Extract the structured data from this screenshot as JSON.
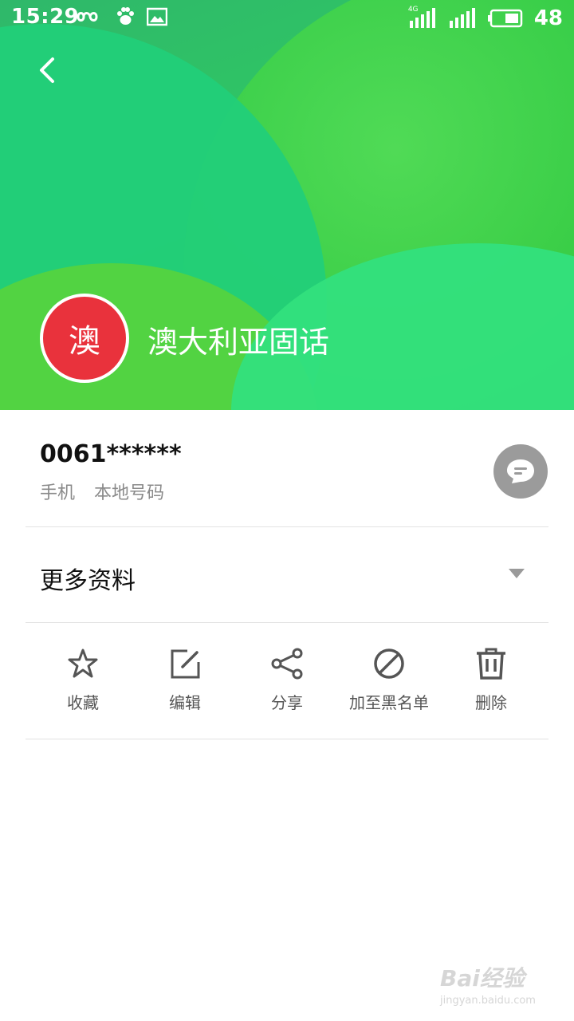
{
  "status_bar": {
    "time": "15:29",
    "network_label": "4G",
    "battery": "48"
  },
  "contact": {
    "avatar_char": "澳",
    "name": "澳大利亚固话",
    "avatar_color": "#e9323c"
  },
  "phone": {
    "number": "0061******",
    "type": "手机",
    "location": "本地号码"
  },
  "more_info": {
    "label": "更多资料"
  },
  "actions": [
    {
      "label": "收藏",
      "icon": "star-icon"
    },
    {
      "label": "编辑",
      "icon": "edit-icon"
    },
    {
      "label": "分享",
      "icon": "share-icon"
    },
    {
      "label": "加至黑名单",
      "icon": "block-icon"
    },
    {
      "label": "删除",
      "icon": "trash-icon"
    }
  ],
  "watermark": {
    "brand": "Bai经验",
    "url": "jingyan.baidu.com"
  },
  "colors": {
    "header_green": "#2fc764",
    "avatar_red": "#e9323c",
    "icon_gray": "#555555"
  }
}
